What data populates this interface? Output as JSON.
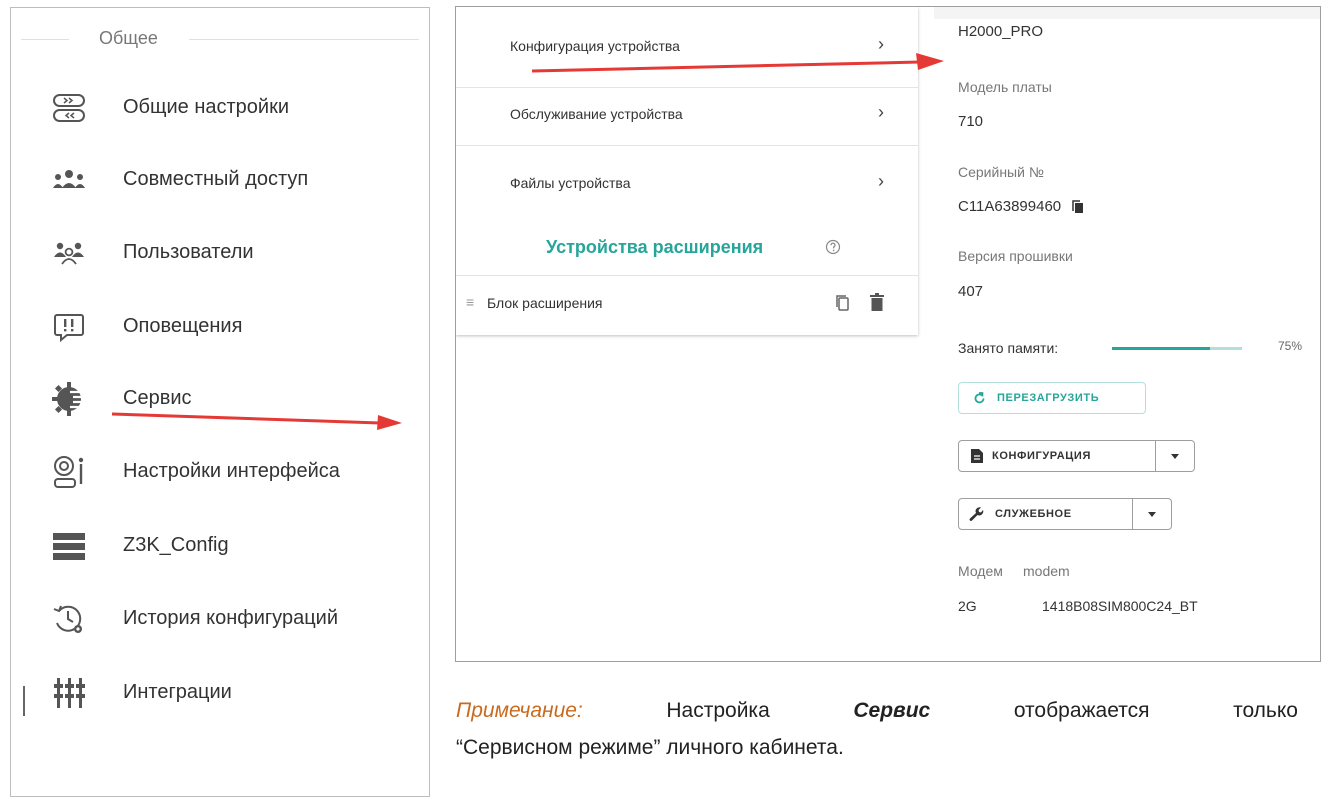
{
  "sidebar": {
    "section_title": "Общее",
    "items": [
      {
        "label": "Общие настройки",
        "icon": "toggle-settings-icon"
      },
      {
        "label": "Совместный доступ",
        "icon": "shared-access-icon"
      },
      {
        "label": "Пользователи",
        "icon": "users-icon"
      },
      {
        "label": "Оповещения",
        "icon": "alert-icon"
      },
      {
        "label": "Сервис",
        "icon": "service-gear-icon"
      },
      {
        "label": "Настройки интерфейса",
        "icon": "interface-settings-icon"
      },
      {
        "label": "Z3K_Config",
        "icon": "server-icon"
      },
      {
        "label": "История конфигураций",
        "icon": "history-icon"
      },
      {
        "label": "Интеграции",
        "icon": "integrations-icon"
      }
    ]
  },
  "device_menu": {
    "rows": [
      {
        "label": "Конфигурация устройства"
      },
      {
        "label": "Обслуживание устройства"
      },
      {
        "label": "Файлы устройства"
      }
    ],
    "chevron": "›",
    "extensions_title": "Устройства расширения",
    "extension_item": "Блок расширения"
  },
  "device_info": {
    "model": "H2000_PRO",
    "board_label": "Модель платы",
    "board_value": "710",
    "serial_label": "Серийный №",
    "serial_value": "C11A63899460",
    "firmware_label": "Версия прошивки",
    "firmware_value": "407",
    "memory_label": "Занято памяти:",
    "memory_value": 0.75,
    "memory_text": "75%",
    "restart_button": "ПЕРЕЗАГРУЗИТЬ",
    "config_button": "КОНФИГУРАЦИЯ",
    "service_button": "СЛУЖЕБНОЕ",
    "modem_header_a": "Модем",
    "modem_header_b": "modem",
    "modem_value_a": "2G",
    "modem_value_b": "1418B08SIM800C24_BT"
  },
  "note": {
    "prefix": "Примечание:",
    "w1": "Настройка",
    "bold": "Сервис",
    "w2": "отображается",
    "w3": "только",
    "line2": "“Сервисном режиме” личного кабинета."
  },
  "colors": {
    "accent": "#26a69a",
    "arrow": "#e53935",
    "note_prefix": "#c96a1e"
  }
}
